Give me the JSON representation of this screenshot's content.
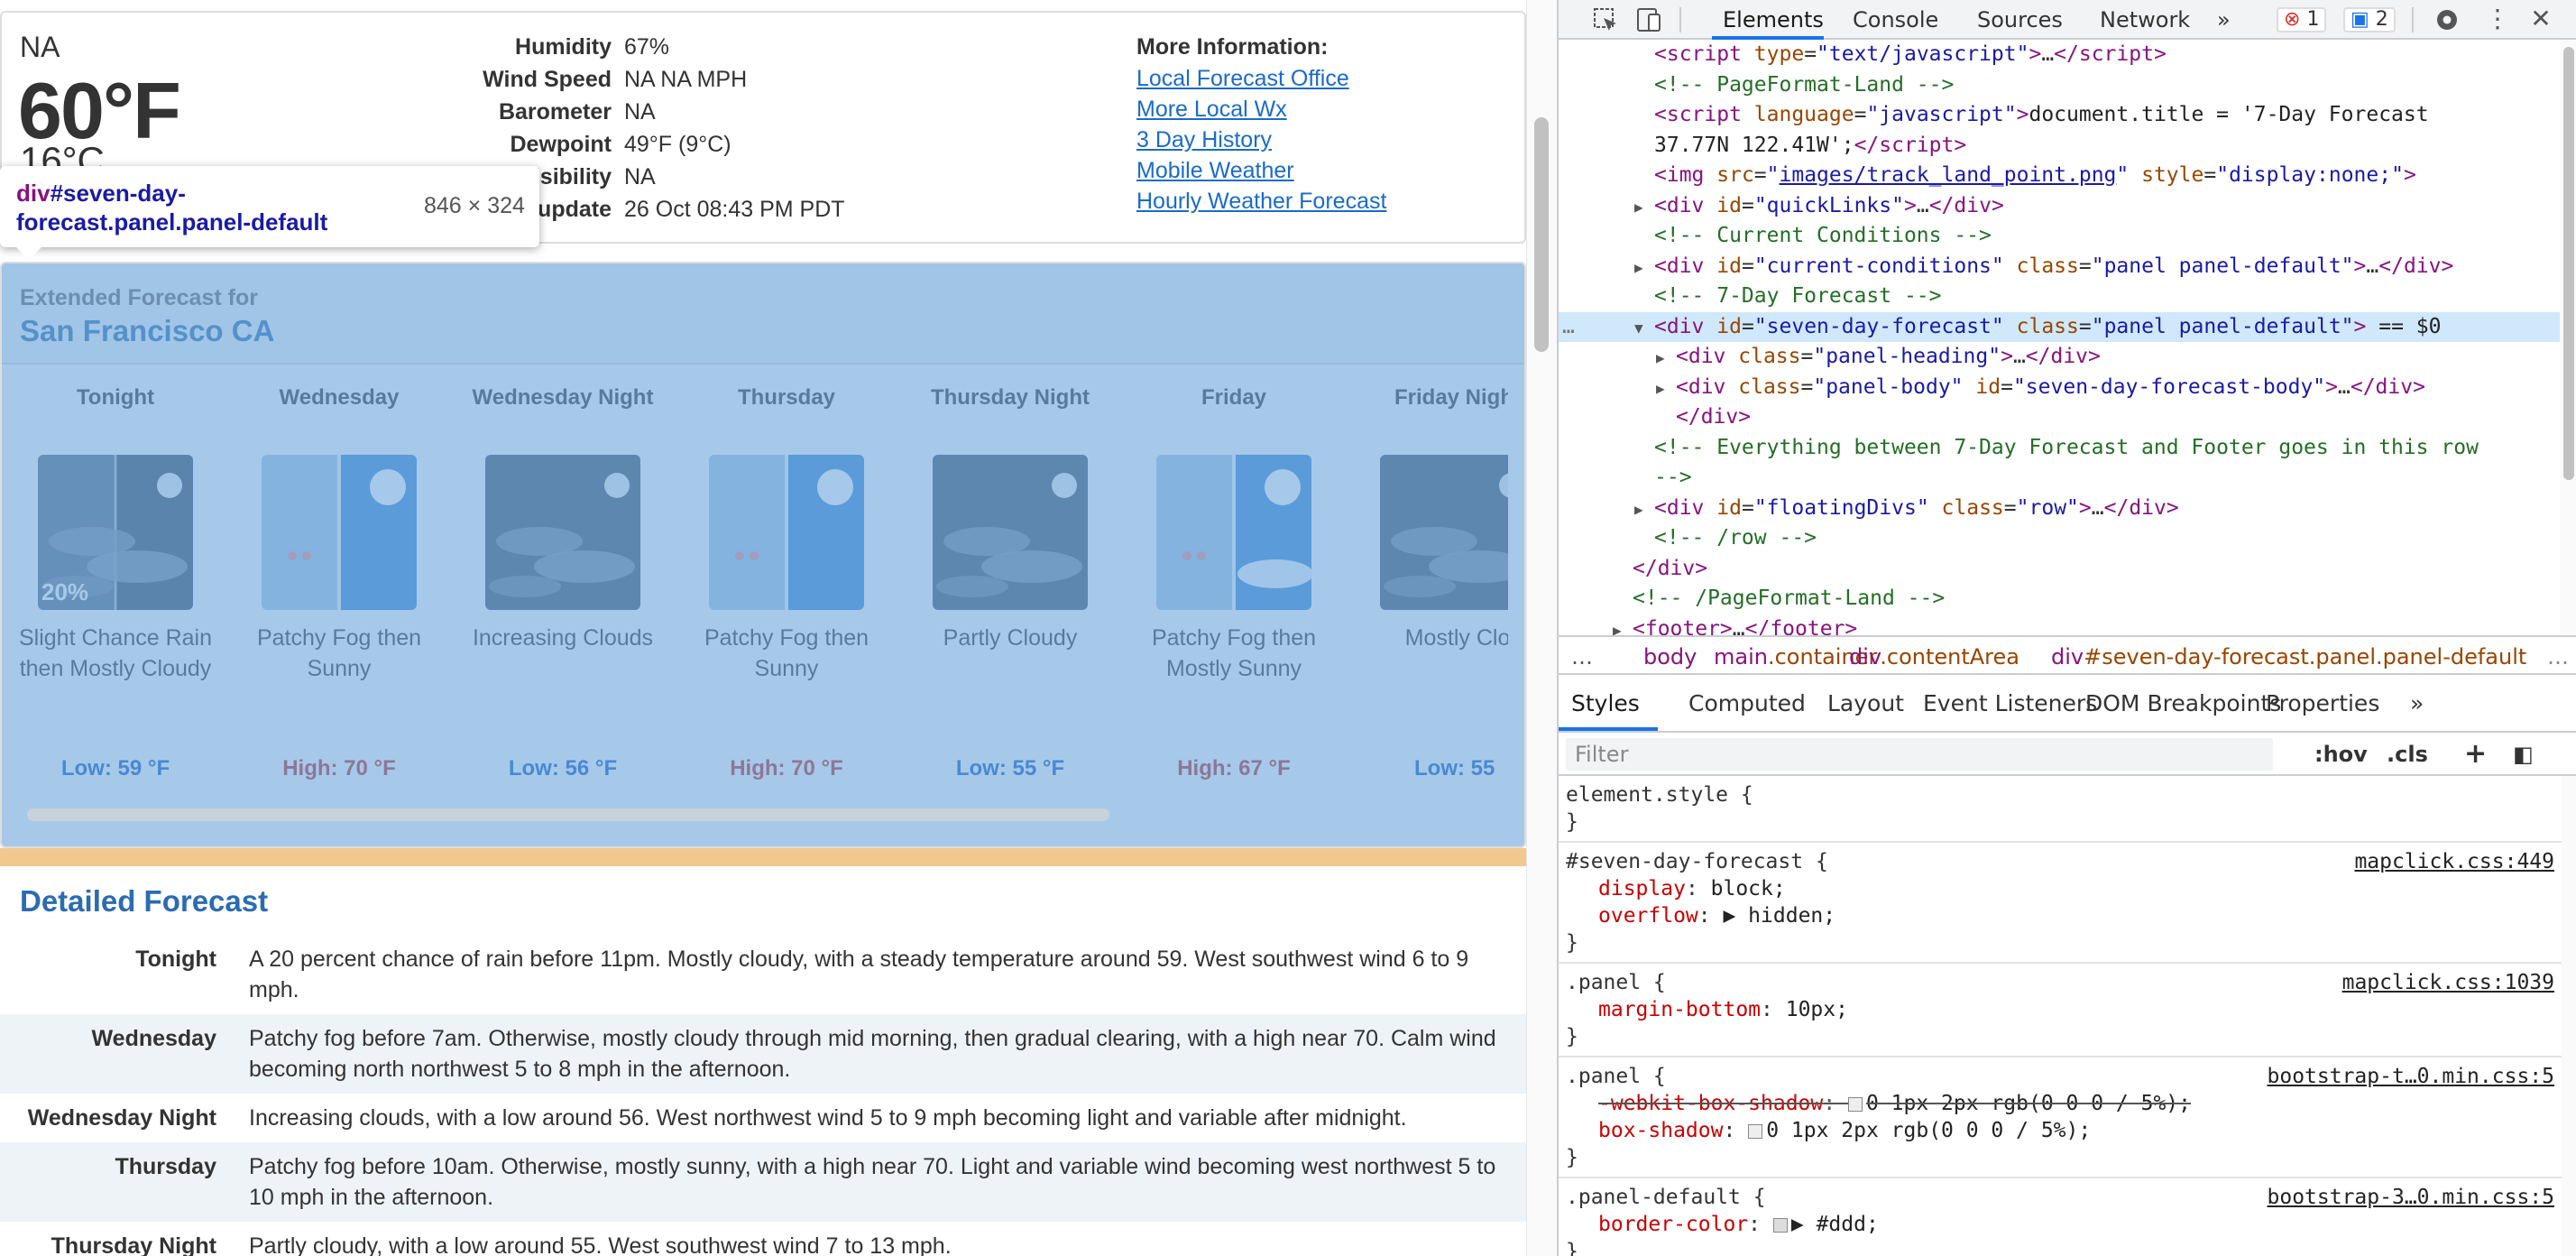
{
  "page": {
    "current": {
      "condition": "NA",
      "temp_f": "60°F",
      "temp_c": "16°C",
      "rows": [
        {
          "k": "Humidity",
          "v": "67%"
        },
        {
          "k": "Wind Speed",
          "v": "NA NA MPH"
        },
        {
          "k": "Barometer",
          "v": "NA"
        },
        {
          "k": "Dewpoint",
          "v": "49°F (9°C)"
        },
        {
          "k": "Visibility",
          "v": "NA"
        },
        {
          "k": "Last update",
          "v": "26 Oct 08:43 PM PDT"
        }
      ],
      "more_title": "More Information:",
      "links": [
        "Local Forecast Office",
        "More Local Wx",
        "3 Day History",
        "Mobile Weather",
        "Hourly Weather Forecast"
      ]
    },
    "tooltip": {
      "selector_tag": "div",
      "selector_rest": "#seven-day-forecast.panel.panel-default",
      "size": "846 × 324"
    },
    "seven_day": {
      "heading1": "Extended Forecast for",
      "heading2": "San Francisco CA",
      "periods": [
        {
          "name": "Tonight",
          "desc": "Slight Chance Rain then Mostly Cloudy",
          "temp": "Low: 59 °F",
          "kind": "lo",
          "pct": "20%",
          "icon": "night-rain-cloudy-icon"
        },
        {
          "name": "Wednesday",
          "desc": "Patchy Fog then Sunny",
          "temp": "High: 70 °F",
          "kind": "hi",
          "pct": "",
          "icon": "fog-sunny-icon"
        },
        {
          "name": "Wednesday Night",
          "desc": "Increasing Clouds",
          "temp": "Low: 56 °F",
          "kind": "lo",
          "pct": "",
          "icon": "night-clouds-icon"
        },
        {
          "name": "Thursday",
          "desc": "Patchy Fog then Sunny",
          "temp": "High: 70 °F",
          "kind": "hi",
          "pct": "",
          "icon": "fog-sunny-icon"
        },
        {
          "name": "Thursday Night",
          "desc": "Partly Cloudy",
          "temp": "Low: 55 °F",
          "kind": "lo",
          "pct": "",
          "icon": "night-partly-cloudy-icon"
        },
        {
          "name": "Friday",
          "desc": "Patchy Fog then Mostly Sunny",
          "temp": "High: 67 °F",
          "kind": "hi",
          "pct": "",
          "icon": "fog-mostly-sunny-icon"
        },
        {
          "name": "Friday Night",
          "desc": "Mostly Clo",
          "temp": "Low: 55",
          "kind": "lo",
          "pct": "",
          "icon": "night-mostly-cloudy-icon"
        }
      ]
    },
    "detailed": {
      "title": "Detailed Forecast",
      "rows": [
        {
          "k": "Tonight",
          "v": "A 20 percent chance of rain before 11pm. Mostly cloudy, with a steady temperature around 59. West southwest wind 6 to 9 mph."
        },
        {
          "k": "Wednesday",
          "v": "Patchy fog before 7am. Otherwise, mostly cloudy through mid morning, then gradual clearing, with a high near 70. Calm wind becoming north northwest 5 to 8 mph in the afternoon."
        },
        {
          "k": "Wednesday Night",
          "v": "Increasing clouds, with a low around 56. West northwest wind 5 to 9 mph becoming light and variable after midnight."
        },
        {
          "k": "Thursday",
          "v": "Patchy fog before 10am. Otherwise, mostly sunny, with a high near 70. Light and variable wind becoming west northwest 5 to 10 mph in the afternoon."
        },
        {
          "k": "Thursday Night",
          "v": "Partly cloudy, with a low around 55. West southwest wind 7 to 13 mph."
        }
      ]
    }
  },
  "devtools": {
    "tabs": [
      "Elements",
      "Console",
      "Sources",
      "Network"
    ],
    "more": "»",
    "errors": "1",
    "messages": "2",
    "dom": [
      {
        "ind": 3,
        "html": "<span class='tag'>&lt;script</span> <span class='an'>type</span>=<span class='av'>\"text/javascript\"</span><span class='tag'>&gt;</span>…<span class='tag'>&lt;/script&gt;</span>"
      },
      {
        "ind": 3,
        "html": "<span class='cm'>&lt;!-- PageFormat-Land --&gt;</span>"
      },
      {
        "ind": 3,
        "html": "<span class='tag'>&lt;script</span> <span class='an'>language</span>=<span class='av'>\"javascript\"</span><span class='tag'>&gt;</span><span class='tx'>document.title = '7-Day Forecast</span>"
      },
      {
        "ind": 3,
        "html": "<span class='tx'>37.77N 122.41W';</span><span class='tag'>&lt;/script&gt;</span>"
      },
      {
        "ind": 3,
        "html": "<span class='tag'>&lt;img</span> <span class='an'>src</span>=<span class='av'>\"</span><span class='lk'>images/track_land_point.png</span><span class='av'>\"</span> <span class='an'>style</span>=<span class='av'>\"display:none;\"</span><span class='tag'>&gt;</span>"
      },
      {
        "ind": 3,
        "tri": "▶",
        "html": "<span class='tag'>&lt;div</span> <span class='an'>id</span>=<span class='av'>\"quickLinks\"</span><span class='tag'>&gt;</span>…<span class='tag'>&lt;/div&gt;</span>"
      },
      {
        "ind": 3,
        "html": "<span class='cm'>&lt;!-- Current Conditions --&gt;</span>"
      },
      {
        "ind": 3,
        "tri": "▶",
        "html": "<span class='tag'>&lt;div</span> <span class='an'>id</span>=<span class='av'>\"current-conditions\"</span> <span class='an'>class</span>=<span class='av'>\"panel panel-default\"</span><span class='tag'>&gt;</span>…<span class='tag'>&lt;/div&gt;</span>"
      },
      {
        "ind": 3,
        "html": "<span class='cm'>&lt;!-- 7-Day Forecast --&gt;</span>"
      },
      {
        "ind": 3,
        "tri": "▼",
        "sel": true,
        "html": "<span class='tag'>&lt;div</span> <span class='an'>id</span>=<span class='av'>\"seven-day-forecast\"</span> <span class='an'>class</span>=<span class='av'>\"panel panel-default\"</span><span class='tag'>&gt;</span> <span class='tx'>== $0</span>"
      },
      {
        "ind": 4,
        "tri": "▶",
        "html": "<span class='tag'>&lt;div</span> <span class='an'>class</span>=<span class='av'>\"panel-heading\"</span><span class='tag'>&gt;</span>…<span class='tag'>&lt;/div&gt;</span>"
      },
      {
        "ind": 4,
        "tri": "▶",
        "html": "<span class='tag'>&lt;div</span> <span class='an'>class</span>=<span class='av'>\"panel-body\"</span> <span class='an'>id</span>=<span class='av'>\"seven-day-forecast-body\"</span><span class='tag'>&gt;</span>…<span class='tag'>&lt;/div&gt;</span>"
      },
      {
        "ind": 4,
        "html": "<span class='tag'>&lt;/div&gt;</span>"
      },
      {
        "ind": 3,
        "html": "<span class='cm'>&lt;!-- Everything between 7-Day Forecast and Footer goes in this row</span>"
      },
      {
        "ind": 3,
        "html": "<span class='cm'>--&gt;</span>"
      },
      {
        "ind": 3,
        "tri": "▶",
        "html": "<span class='tag'>&lt;div</span> <span class='an'>id</span>=<span class='av'>\"floatingDivs\"</span> <span class='an'>class</span>=<span class='av'>\"row\"</span><span class='tag'>&gt;</span>…<span class='tag'>&lt;/div&gt;</span>"
      },
      {
        "ind": 3,
        "html": "<span class='cm'>&lt;!-- /row  --&gt;</span>"
      },
      {
        "ind": 2,
        "html": "<span class='tag'>&lt;/div&gt;</span>"
      },
      {
        "ind": 2,
        "html": "<span class='cm'>&lt;!-- /PageFormat-Land --&gt;</span>"
      },
      {
        "ind": 2,
        "tri": "▶",
        "html": "<span class='tag'>&lt;footer&gt;</span>…<span class='tag'>&lt;/footer&gt;</span>"
      }
    ],
    "breadcrumb": [
      "body",
      "main.container",
      "div.contentArea",
      "div#seven-day-forecast.panel.panel-default"
    ],
    "style_tabs": [
      "Styles",
      "Computed",
      "Layout",
      "Event Listeners",
      "DOM Breakpoints",
      "Properties"
    ],
    "filter_placeholder": "Filter",
    "hov": ":hov",
    "cls": ".cls",
    "rules": [
      {
        "sel": "element.style {",
        "src": "",
        "props": []
      },
      {
        "sel": "#seven-day-forecast {",
        "src": "mapclick.css:449",
        "props": [
          [
            "display",
            "block;"
          ],
          [
            "overflow",
            "▶ hidden;"
          ]
        ]
      },
      {
        "sel": ".panel {",
        "src": "mapclick.css:1039",
        "props": [
          [
            "margin-bottom",
            "10px;"
          ]
        ]
      },
      {
        "sel": ".panel {",
        "src": "bootstrap-t…0.min.css:5",
        "props": [
          [
            "-webkit-box-shadow",
            "0 1px 2px rgb(0 0 0 / 5%);",
            "strike"
          ],
          [
            "box-shadow",
            "0 1px 2px rgb(0 0 0 / 5%);"
          ]
        ]
      },
      {
        "sel": ".panel-default {",
        "src": "bootstrap-3…0.min.css:5",
        "props": [
          [
            "border-color",
            "▶ #ddd;"
          ]
        ]
      }
    ]
  }
}
